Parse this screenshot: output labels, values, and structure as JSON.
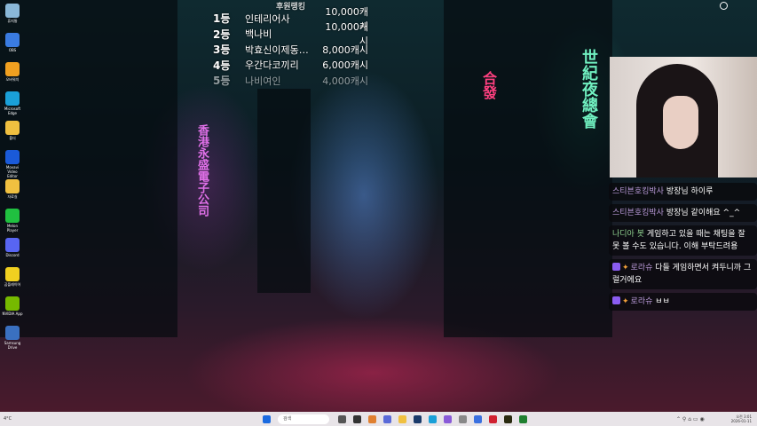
{
  "ranking": {
    "title": "후원랭킹",
    "rows": [
      {
        "place": "1등",
        "name": "인테리어사",
        "amount": "10,000캐시"
      },
      {
        "place": "2등",
        "name": "백나비",
        "amount": "10,000캐시"
      },
      {
        "place": "3등",
        "name": "박효신이제동…",
        "amount": "8,000캐시"
      },
      {
        "place": "4등",
        "name": "우간다코끼리",
        "amount": "6,000캐시"
      },
      {
        "place": "5등",
        "name": "나비여인",
        "amount": "4,000캐시"
      }
    ]
  },
  "desktop_icons": [
    {
      "label": "휴지통",
      "color": "#8ab8d8"
    },
    {
      "label": "OBS",
      "color": "#3a7be0"
    },
    {
      "label": "오버워치",
      "color": "#f0a020"
    },
    {
      "label": "Microsoft Edge",
      "color": "#1aa0d8"
    },
    {
      "label": "폴더",
      "color": "#f0c040"
    },
    {
      "label": "Movavi Video Editor",
      "color": "#1a5ad8"
    },
    {
      "label": "자료실",
      "color": "#f0c040"
    },
    {
      "label": "Melon Player",
      "color": "#20c040"
    },
    {
      "label": "Discord",
      "color": "#5865f2"
    },
    {
      "label": "곰플레이어",
      "color": "#f0d020"
    },
    {
      "label": "NVIDIA App",
      "color": "#76b900"
    },
    {
      "label": "Samsung Drive",
      "color": "#3a70c0"
    }
  ],
  "wallpaper_signs": [
    "香港永盛電子公司",
    "合發",
    "世紀夜總會"
  ],
  "chat": [
    {
      "nick": "스티븐호킹박사",
      "text": "방장님 하이루",
      "badge": false
    },
    {
      "nick": "스티븐호킹박사",
      "text": "방장님 같이해요 ^_^",
      "badge": false
    },
    {
      "nick": "나디아 봇",
      "text": "게임하고 있을 때는 채팅을 잘 못 볼 수도 있습니다. 이해 부탁드려용",
      "badge": false,
      "bot": true
    },
    {
      "nick": "로라슈",
      "text": "다들 게임하면서 켜두니까 그럴거에요",
      "badge": true
    },
    {
      "nick": "로라슈",
      "text": "ㅂㅂ",
      "badge": true
    }
  ],
  "taskbar": {
    "search_placeholder": "검색",
    "weather": "4°C",
    "time": "오전 3:01",
    "date": "2026-01-11"
  },
  "colors": {
    "taskbar": "#e8e4e8",
    "accent": "#8a5cf0"
  }
}
